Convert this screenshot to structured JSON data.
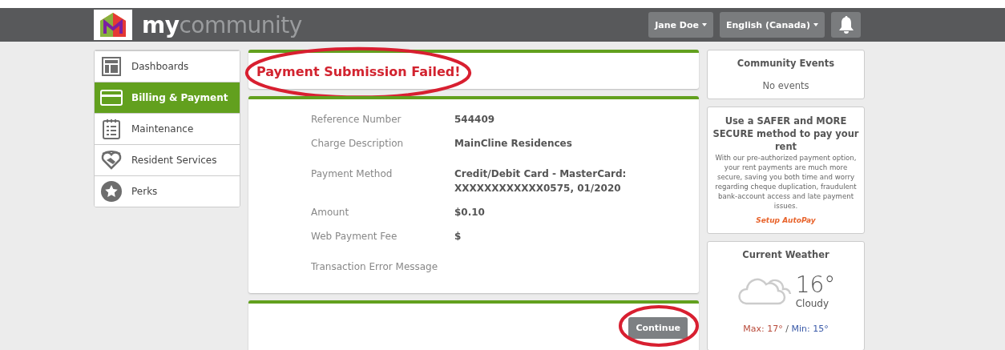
{
  "header": {
    "logo_text": {
      "bold": "my",
      "light": "community"
    },
    "user_menu": "Jane Doe",
    "language_menu": "English (Canada)"
  },
  "sidebar": {
    "items": [
      {
        "label": "Dashboards",
        "selected": false
      },
      {
        "label": "Billing & Payment",
        "selected": true
      },
      {
        "label": "Maintenance",
        "selected": false
      },
      {
        "label": "Resident Services",
        "selected": false
      },
      {
        "label": "Perks",
        "selected": false
      }
    ]
  },
  "alert": {
    "title": "Payment Submission Failed!",
    "circled": true
  },
  "details": [
    {
      "label": "Reference Number",
      "value": "544409"
    },
    {
      "label": "Charge Description",
      "value": "MainCline Residences"
    },
    {
      "label": "Payment Method",
      "value": "Credit/Debit Card - MasterCard: XXXXXXXXXXXX0575, 01/2020"
    },
    {
      "label": "Amount",
      "value": "$0.10"
    },
    {
      "label": "Web Payment Fee",
      "value": "$"
    },
    {
      "label": "Transaction Error Message"
    }
  ],
  "continue_button": {
    "label": "Continue",
    "circled": true
  },
  "events": {
    "title": "Community Events",
    "empty_text": "No events"
  },
  "promo": {
    "title": "Use a SAFER and MORE SECURE method to pay your rent",
    "body": "With our pre-authorized payment option, your rent payments are much more secure, saving you both time and worry regarding cheque duplication, fraudulent bank-account access and late payment issues.",
    "link": "Setup AutoPay"
  },
  "weather": {
    "title": "Current Weather",
    "temperature": "16°",
    "condition": "Cloudy",
    "max": "Max: 17°",
    "separator": "/",
    "min": "Min: 15°"
  }
}
